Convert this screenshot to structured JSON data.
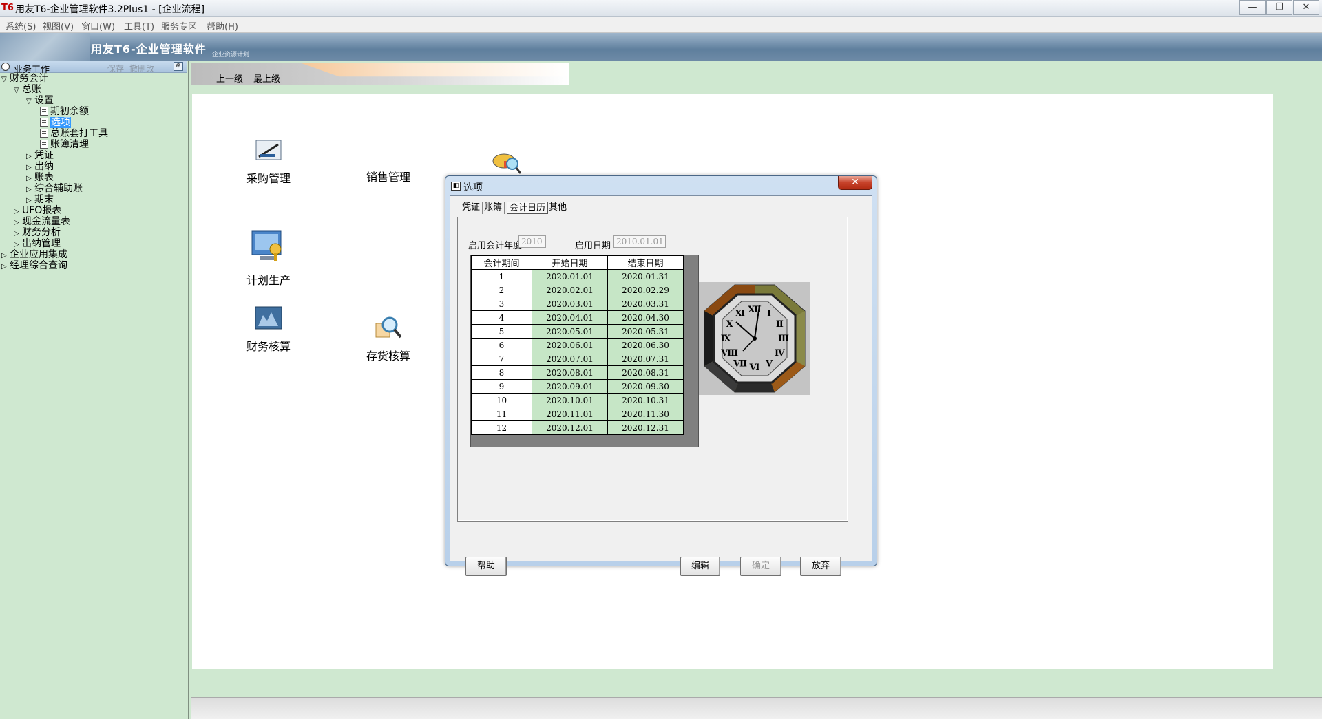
{
  "window": {
    "logo": "T6",
    "title": "用友T6-企业管理软件3.2Plus1 - [企业流程]",
    "minimize_glyph": "—",
    "restore_glyph": "❐",
    "close_glyph": "✕"
  },
  "menu": [
    "系统(S)",
    "视图(V)",
    "窗口(W)",
    "工具(T)",
    "服务专区",
    "帮助(H)"
  ],
  "banner": {
    "brand": "用友T6-企业管理软件",
    "sub": "企业资源计划"
  },
  "tree": {
    "header": {
      "title": "业务工作",
      "save": "保存",
      "restore": "撤删改",
      "pin_glyph": "⊕"
    },
    "nodes": [
      {
        "label": "财务会计"
      },
      {
        "label": "总账"
      },
      {
        "label": "设置"
      },
      {
        "label": "期初余额"
      },
      {
        "label": "选项"
      },
      {
        "label": "总账套打工具"
      },
      {
        "label": "账簿清理"
      },
      {
        "label": "凭证"
      },
      {
        "label": "出纳"
      },
      {
        "label": "账表"
      },
      {
        "label": "综合辅助账"
      },
      {
        "label": "期末"
      },
      {
        "label": "UFO报表"
      },
      {
        "label": "现金流量表"
      },
      {
        "label": "财务分析"
      },
      {
        "label": "出纳管理"
      },
      {
        "label": "企业应用集成"
      },
      {
        "label": "经理综合查询"
      }
    ]
  },
  "nav": {
    "up": "上一级",
    "top": "最上级"
  },
  "modules": {
    "purchase": "采购管理",
    "sales": "销售管理",
    "planning": "计划生产",
    "finance": "财务核算",
    "inventory": "存货核算"
  },
  "dialog": {
    "title": "选项",
    "close_glyph": "✕",
    "icon_glyph": "◧",
    "tabs": [
      "凭证",
      "账簿",
      "会计日历",
      "其他"
    ],
    "start_year_label": "启用会计年度",
    "start_year_value": "2010",
    "start_date_label": "启用日期",
    "start_date_value": "2010.01.01",
    "grid": {
      "headers": [
        "会计期间",
        "开始日期",
        "结束日期"
      ],
      "rows": [
        [
          "1",
          "2020.01.01",
          "2020.01.31"
        ],
        [
          "2",
          "2020.02.01",
          "2020.02.29"
        ],
        [
          "3",
          "2020.03.01",
          "2020.03.31"
        ],
        [
          "4",
          "2020.04.01",
          "2020.04.30"
        ],
        [
          "5",
          "2020.05.01",
          "2020.05.31"
        ],
        [
          "6",
          "2020.06.01",
          "2020.06.30"
        ],
        [
          "7",
          "2020.07.01",
          "2020.07.31"
        ],
        [
          "8",
          "2020.08.01",
          "2020.08.31"
        ],
        [
          "9",
          "2020.09.01",
          "2020.09.30"
        ],
        [
          "10",
          "2020.10.01",
          "2020.10.31"
        ],
        [
          "11",
          "2020.11.01",
          "2020.11.30"
        ],
        [
          "12",
          "2020.12.01",
          "2020.12.31"
        ]
      ]
    },
    "clock_numerals": [
      "Ⅻ",
      "Ⅰ",
      "Ⅱ",
      "Ⅲ",
      "Ⅳ",
      "Ⅴ",
      "Ⅵ",
      "Ⅶ",
      "Ⅷ",
      "Ⅸ",
      "Ⅹ",
      "Ⅺ"
    ],
    "buttons": {
      "help": "帮助",
      "edit": "编辑",
      "ok": "确定",
      "cancel": "放弃"
    }
  }
}
